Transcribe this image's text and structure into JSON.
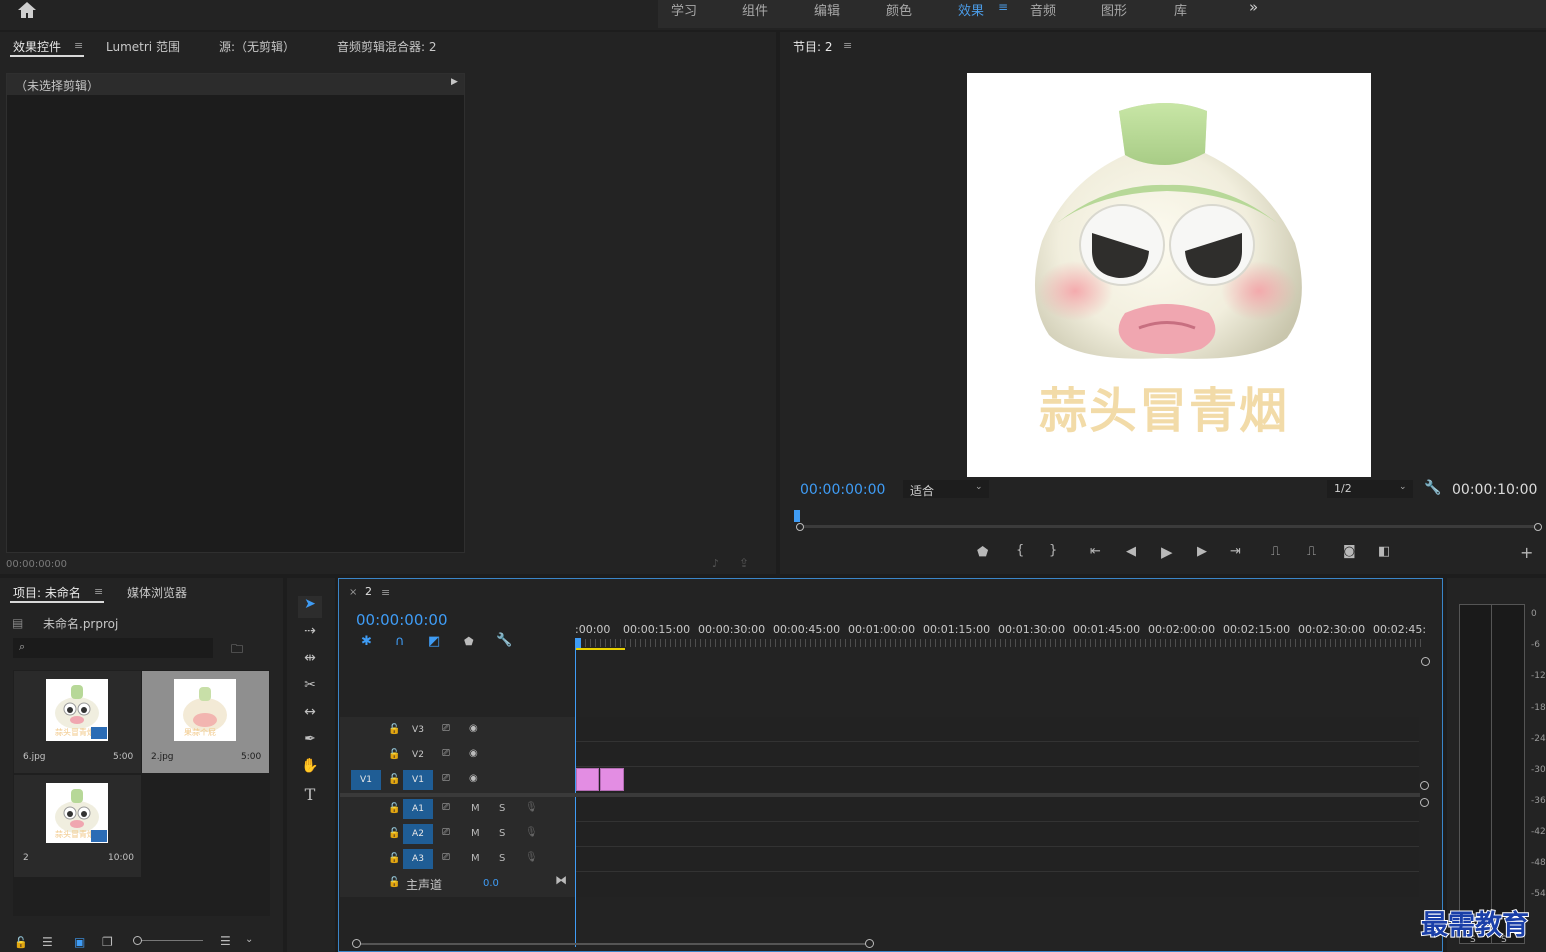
{
  "workspaces": {
    "items": [
      "学习",
      "组件",
      "编辑",
      "颜色",
      "效果",
      "音频",
      "图形",
      "库"
    ],
    "active": "效果",
    "more": "»"
  },
  "effect_controls": {
    "tabs": [
      "效果控件",
      "Lumetri 范围",
      "源:（无剪辑）",
      "音频剪辑混合器: 2"
    ],
    "no_clip_label": "（未选择剪辑）",
    "timecode": "00:00:00:00"
  },
  "program": {
    "title": "节目: 2",
    "timecode": "00:00:00:00",
    "fit_select": "适合",
    "resolution_select": "1/2",
    "duration": "00:00:10:00",
    "preview_text": "蒜头冒青烟"
  },
  "project": {
    "tabs": [
      "项目: 未命名",
      "媒体浏览器"
    ],
    "file_name": "未命名.prproj",
    "search_placeholder": "",
    "items": [
      {
        "name": "6.jpg",
        "duration": "5:00",
        "thumb_text": "蒜头冒青烟",
        "selected": false
      },
      {
        "name": "2.jpg",
        "duration": "5:00",
        "thumb_text": "果蒜个屁",
        "selected": true
      },
      {
        "name": "2",
        "duration": "10:00",
        "thumb_text": "蒜头冒青烟",
        "selected": false
      }
    ]
  },
  "timeline": {
    "sequence_name": "2",
    "timecode": "00:00:00:00",
    "ruler_labels": [
      ":00:00",
      "00:00:15:00",
      "00:00:30:00",
      "00:00:45:00",
      "00:01:00:00",
      "00:01:15:00",
      "00:01:30:00",
      "00:01:45:00",
      "00:02:00:00",
      "00:02:15:00",
      "00:02:30:00",
      "00:02:45:"
    ],
    "video_tracks": [
      "V3",
      "V2",
      "V1"
    ],
    "source_patch": "V1",
    "audio_tracks": [
      "A1",
      "A2",
      "A3"
    ],
    "mute": "M",
    "solo": "S",
    "master_label": "主声道",
    "master_value": "0.0"
  },
  "audio_meter": {
    "labels": [
      "0",
      "-6",
      "-12",
      "-18",
      "-24",
      "-30",
      "-36",
      "-42",
      "-48",
      "-54"
    ],
    "solo": "S"
  },
  "watermark": "最需教育",
  "colors": {
    "accent_blue": "#3f9cf5",
    "clip_pink": "#e38de3",
    "patch_blue": "#1f5d95",
    "panel_bg": "#232323"
  }
}
